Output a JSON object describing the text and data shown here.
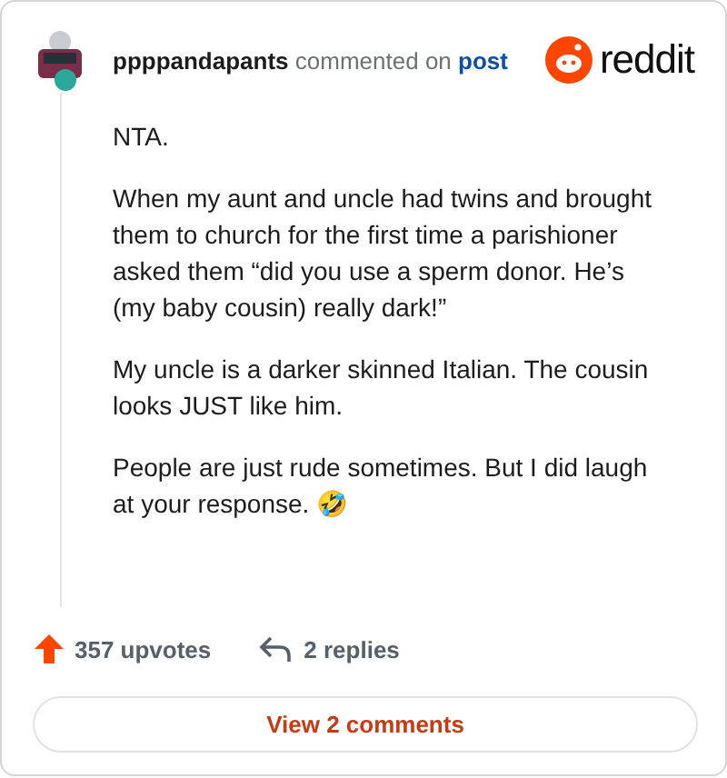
{
  "header": {
    "username": "ppppandapants",
    "action": "commented on",
    "link": "post",
    "brand": "reddit"
  },
  "comment": {
    "paragraphs": [
      "NTA.",
      "When my aunt and uncle had twins and brought them to church for the first time a parishioner asked them “did you use a sperm donor. He’s (my baby cousin) really dark!”",
      "My uncle is a darker skinned Italian. The cousin looks JUST like him.",
      "People are just rude sometimes. But I did laugh at your response. 🤣"
    ]
  },
  "stats": {
    "upvotes": "357 upvotes",
    "upvoted": true,
    "replies": "2 replies"
  },
  "button": {
    "label": "View 2 comments"
  }
}
